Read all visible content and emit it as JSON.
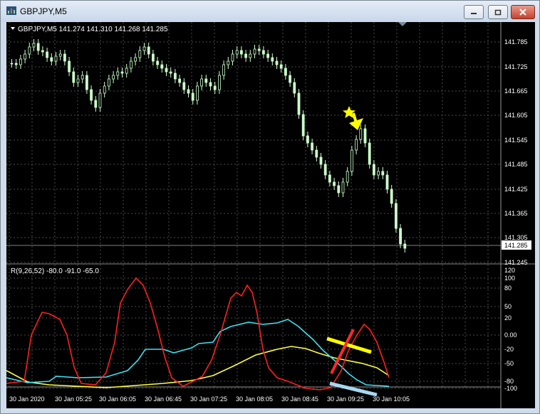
{
  "window": {
    "title": "GBPJPY,M5"
  },
  "main_chart": {
    "header": "GBPJPY,M5  141.274 141.310 141.268 141.285",
    "price_ticks": [
      "141.785",
      "141.725",
      "141.665",
      "141.605",
      "141.545",
      "141.485",
      "141.425",
      "141.365",
      "141.305",
      "141.245"
    ],
    "current_price": "141.285"
  },
  "indicator": {
    "header": "R(9,26,52) -80.0 -91.0 -65.0",
    "ticks": [
      "120",
      "100",
      "80",
      "50",
      "20",
      "0.00",
      "-20",
      "-50",
      "-80",
      "-100"
    ]
  },
  "time_labels": [
    "30 Jan 2020",
    "30 Jan 05:25",
    "30 Jan 06:05",
    "30 Jan 06:45",
    "30 Jan 07:25",
    "30 Jan 08:05",
    "30 Jan 08:45",
    "30 Jan 09:25",
    "30 Jan 10:05"
  ],
  "colors": {
    "up_candle": "#ccffcc",
    "down_candle": "#ffffff",
    "fast_line": "#ff2020",
    "mid_line": "#3ee0f0",
    "slow_line": "#ffff40",
    "annotation_yellow": "#ffff00",
    "annotation_red": "#ff2a2a",
    "annotation_blue": "#a8d8f0"
  }
}
